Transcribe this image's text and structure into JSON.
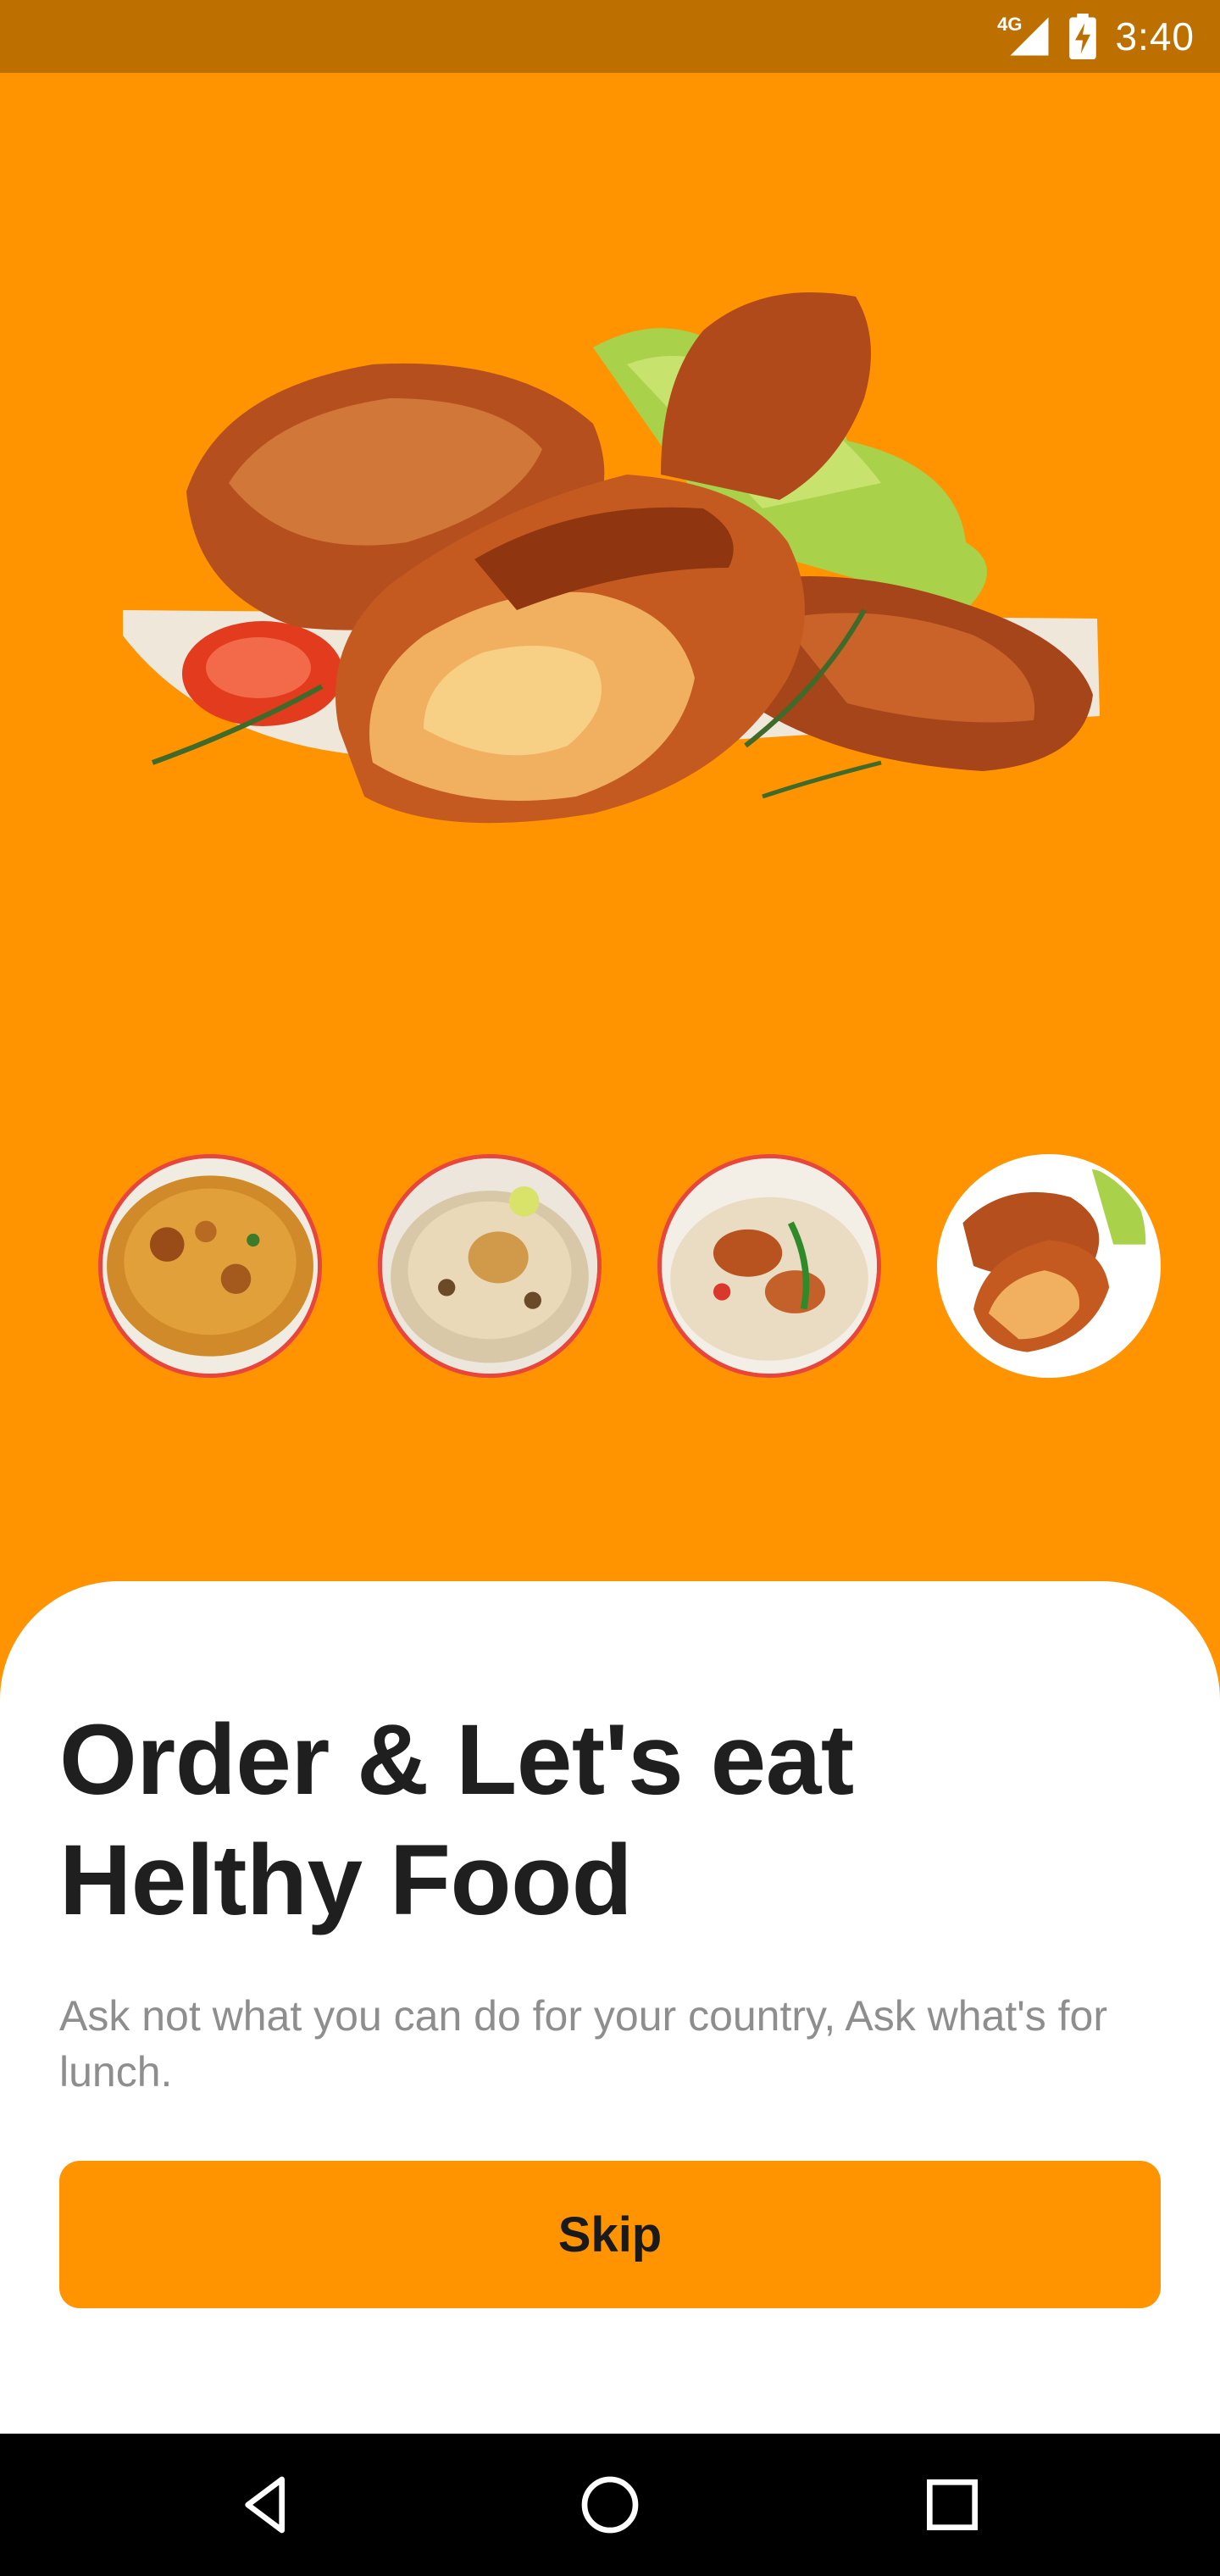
{
  "status_bar": {
    "network": "4G",
    "time": "3:40",
    "signal_icon": "signal-icon",
    "battery_icon": "battery-charging-icon"
  },
  "hero": {
    "image": "roasted-chicken-legs-image"
  },
  "thumbnails": [
    {
      "image": "biryani-plate-image",
      "selected": false
    },
    {
      "image": "chicken-pulao-image",
      "selected": false
    },
    {
      "image": "chicken-rice-image",
      "selected": false
    },
    {
      "image": "chicken-legs-image",
      "selected": true
    }
  ],
  "onboarding": {
    "title_line1": "Order & Let's eat",
    "title_line2": "Helthy Food",
    "subtitle": "Ask not what you can do for your country, Ask what's for lunch.",
    "skip_label": "Skip"
  },
  "nav_bar": {
    "back_icon": "back-icon",
    "home_icon": "home-icon",
    "recents_icon": "recents-icon"
  },
  "colors": {
    "primary": "#ff9400",
    "status_bar": "#bd7000",
    "thumb_border": "#e8453c",
    "thumb_active_border": "#ffffff",
    "title": "#1f1f1f",
    "subtitle": "#8e8e8e"
  }
}
